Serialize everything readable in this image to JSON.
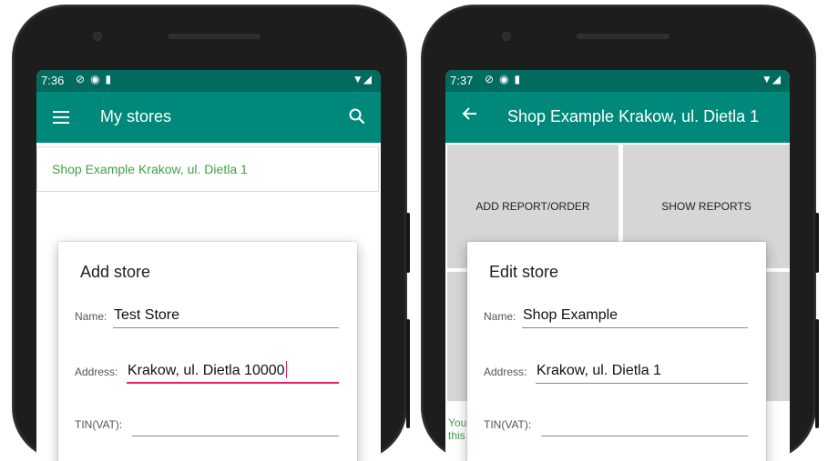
{
  "left_screen": {
    "status": {
      "time": "7:36"
    },
    "appbar": {
      "title": "My stores",
      "menu_icon": "menu-icon",
      "search_icon": "search-icon"
    },
    "stores": [
      {
        "label": "Shop Example Krakow, ul. Dietla 1"
      }
    ],
    "dialog": {
      "title": "Add store",
      "fields": [
        {
          "label": "Name:",
          "value": "Test Store"
        },
        {
          "label": "Address:",
          "value": "Krakow, ul. Dietla 10000"
        },
        {
          "label": "TIN(VAT):",
          "value": ""
        }
      ]
    }
  },
  "right_screen": {
    "status": {
      "time": "7:37"
    },
    "appbar": {
      "title": "Shop Example Krakow, ul. Dietla 1",
      "back_icon": "back-arrow-icon"
    },
    "tiles": [
      {
        "label": "ADD REPORT/ORDER"
      },
      {
        "label": "SHOW REPORTS"
      }
    ],
    "note": "You\nthis",
    "dialog": {
      "title": "Edit store",
      "fields": [
        {
          "label": "Name:",
          "value": "Shop Example"
        },
        {
          "label": "Address:",
          "value": "Krakow, ul. Dietla 1"
        },
        {
          "label": "TIN(VAT):",
          "value": ""
        }
      ]
    }
  },
  "colors": {
    "status_bar": "#006b5e",
    "app_bar": "#00897b",
    "store_text": "#43a047",
    "focus_line": "#e91e63",
    "tile": "#d6d6d6"
  }
}
